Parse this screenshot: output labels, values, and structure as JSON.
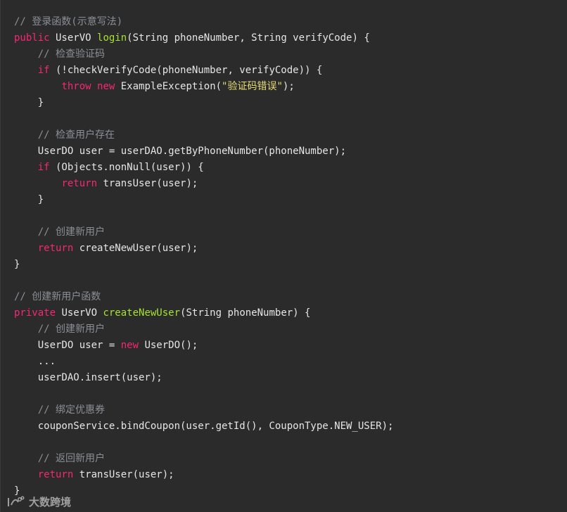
{
  "lines": [
    [
      {
        "t": "// 登录函数(示意写法)",
        "c": "comment"
      }
    ],
    [
      {
        "t": "public",
        "c": "kw"
      },
      {
        "t": " UserVO ",
        "c": "plain"
      },
      {
        "t": "login",
        "c": "fn"
      },
      {
        "t": "(String phoneNumber, String verifyCode) {",
        "c": "plain"
      }
    ],
    [
      {
        "t": "    ",
        "c": "plain"
      },
      {
        "t": "// 检查验证码",
        "c": "comment"
      }
    ],
    [
      {
        "t": "    ",
        "c": "plain"
      },
      {
        "t": "if",
        "c": "kw"
      },
      {
        "t": " (!checkVerifyCode(phoneNumber, verifyCode)) {",
        "c": "plain"
      }
    ],
    [
      {
        "t": "        ",
        "c": "plain"
      },
      {
        "t": "throw",
        "c": "kw"
      },
      {
        "t": " ",
        "c": "plain"
      },
      {
        "t": "new",
        "c": "kw"
      },
      {
        "t": " ExampleException(",
        "c": "plain"
      },
      {
        "t": "\"验证码错误\"",
        "c": "str"
      },
      {
        "t": ");",
        "c": "plain"
      }
    ],
    [
      {
        "t": "    }",
        "c": "plain"
      }
    ],
    [
      {
        "t": "",
        "c": "plain"
      }
    ],
    [
      {
        "t": "    ",
        "c": "plain"
      },
      {
        "t": "// 检查用户存在",
        "c": "comment"
      }
    ],
    [
      {
        "t": "    UserDO user = userDAO.getByPhoneNumber(phoneNumber);",
        "c": "plain"
      }
    ],
    [
      {
        "t": "    ",
        "c": "plain"
      },
      {
        "t": "if",
        "c": "kw"
      },
      {
        "t": " (Objects.nonNull(user)) {",
        "c": "plain"
      }
    ],
    [
      {
        "t": "        ",
        "c": "plain"
      },
      {
        "t": "return",
        "c": "kw"
      },
      {
        "t": " transUser(user);",
        "c": "plain"
      }
    ],
    [
      {
        "t": "    }",
        "c": "plain"
      }
    ],
    [
      {
        "t": "",
        "c": "plain"
      }
    ],
    [
      {
        "t": "    ",
        "c": "plain"
      },
      {
        "t": "// 创建新用户",
        "c": "comment"
      }
    ],
    [
      {
        "t": "    ",
        "c": "plain"
      },
      {
        "t": "return",
        "c": "kw"
      },
      {
        "t": " createNewUser(user);",
        "c": "plain"
      }
    ],
    [
      {
        "t": "}",
        "c": "plain"
      }
    ],
    [
      {
        "t": "",
        "c": "plain"
      }
    ],
    [
      {
        "t": "// 创建新用户函数",
        "c": "comment"
      }
    ],
    [
      {
        "t": "private",
        "c": "kw"
      },
      {
        "t": " UserVO ",
        "c": "plain"
      },
      {
        "t": "createNewUser",
        "c": "fn"
      },
      {
        "t": "(String phoneNumber) {",
        "c": "plain"
      }
    ],
    [
      {
        "t": "    ",
        "c": "plain"
      },
      {
        "t": "// 创建新用户",
        "c": "comment"
      }
    ],
    [
      {
        "t": "    UserDO user = ",
        "c": "plain"
      },
      {
        "t": "new",
        "c": "kw"
      },
      {
        "t": " UserDO();",
        "c": "plain"
      }
    ],
    [
      {
        "t": "    ...",
        "c": "plain"
      }
    ],
    [
      {
        "t": "    userDAO.insert(user);",
        "c": "plain"
      }
    ],
    [
      {
        "t": "",
        "c": "plain"
      }
    ],
    [
      {
        "t": "    ",
        "c": "plain"
      },
      {
        "t": "// 绑定优惠券",
        "c": "comment"
      }
    ],
    [
      {
        "t": "    couponService.bindCoupon(user.getId(), CouponType.NEW_USER);",
        "c": "plain"
      }
    ],
    [
      {
        "t": "",
        "c": "plain"
      }
    ],
    [
      {
        "t": "    ",
        "c": "plain"
      },
      {
        "t": "// 返回新用户",
        "c": "comment"
      }
    ],
    [
      {
        "t": "    ",
        "c": "plain"
      },
      {
        "t": "return",
        "c": "kw"
      },
      {
        "t": " transUser(user);",
        "c": "plain"
      }
    ],
    [
      {
        "t": "}",
        "c": "plain"
      }
    ]
  ],
  "watermark": {
    "text": "大数跨境",
    "icon": "brand-logo-icon"
  },
  "colors": {
    "background": "#2b2b2b",
    "comment": "#8a8f95",
    "keyword": "#f92672",
    "function": "#a6e22e",
    "string": "#e6db74",
    "text": "#e6e6e6"
  }
}
